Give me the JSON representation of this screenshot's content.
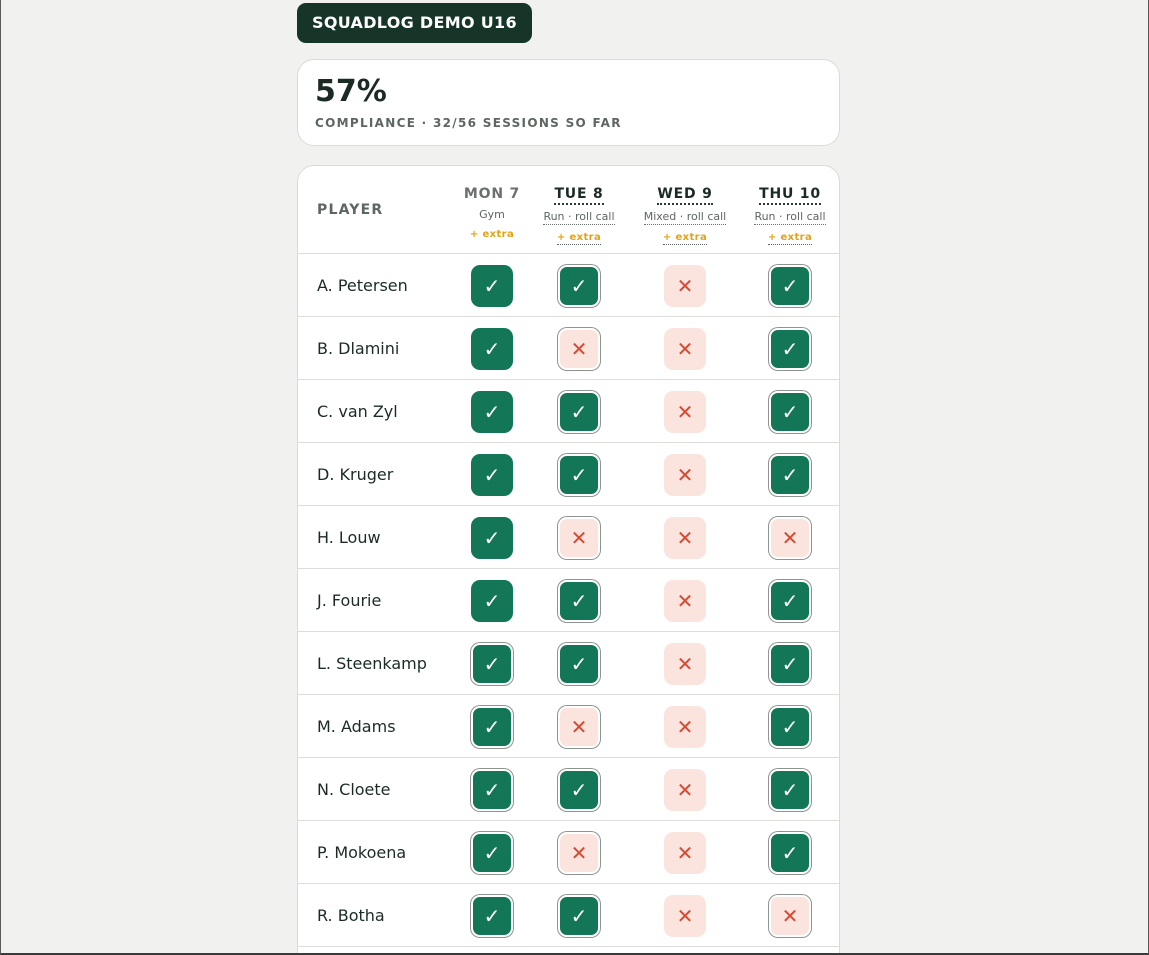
{
  "team_name": "SQUADLOG DEMO U16",
  "summary": {
    "percent": "57%",
    "subtitle": "COMPLIANCE · 32/56 SESSIONS SO FAR"
  },
  "table": {
    "player_header": "PLAYER",
    "days": [
      {
        "name": "MON 7",
        "type": "Gym",
        "extra": "+ extra"
      },
      {
        "name": "TUE 8",
        "type": "Run · roll call",
        "extra": "+ extra"
      },
      {
        "name": "WED 9",
        "type": "Mixed · roll call",
        "extra": "+ extra"
      },
      {
        "name": "THU 10",
        "type": "Run · roll call",
        "extra": "+ extra"
      }
    ],
    "players": [
      {
        "name": "A. Petersen",
        "sessions": [
          "done",
          "done",
          "missed",
          "done"
        ]
      },
      {
        "name": "B. Dlamini",
        "sessions": [
          "done",
          "missed",
          "missed",
          "done"
        ]
      },
      {
        "name": "C. van Zyl",
        "sessions": [
          "done",
          "done",
          "missed",
          "done"
        ]
      },
      {
        "name": "D. Kruger",
        "sessions": [
          "done",
          "done",
          "missed",
          "done"
        ]
      },
      {
        "name": "H. Louw",
        "sessions": [
          "done",
          "missed",
          "missed",
          "missed"
        ]
      },
      {
        "name": "J. Fourie",
        "sessions": [
          "done",
          "done",
          "missed",
          "done"
        ]
      },
      {
        "name": "L. Steenkamp",
        "sessions": [
          "done",
          "done",
          "missed",
          "done"
        ]
      },
      {
        "name": "M. Adams",
        "sessions": [
          "done",
          "missed",
          "missed",
          "done"
        ]
      },
      {
        "name": "N. Cloete",
        "sessions": [
          "done",
          "done",
          "missed",
          "done"
        ]
      },
      {
        "name": "P. Mokoena",
        "sessions": [
          "done",
          "missed",
          "missed",
          "done"
        ]
      },
      {
        "name": "R. Botha",
        "sessions": [
          "done",
          "done",
          "missed",
          "missed"
        ]
      }
    ]
  },
  "icons": {
    "done": "check-icon",
    "missed": "cross-icon"
  },
  "colors": {
    "badge": "#163427",
    "done": "#137656",
    "missed_bg": "#fbe4de",
    "missed_mark": "#d54a33",
    "extra": "#e3a214"
  }
}
